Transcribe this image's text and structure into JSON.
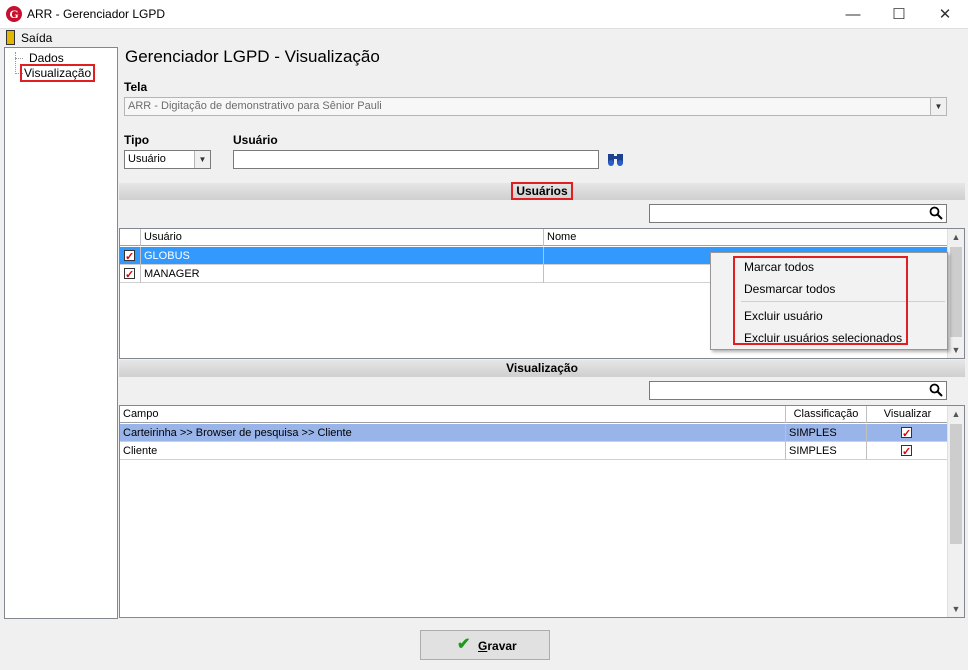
{
  "window": {
    "title": "ARR - Gerenciador LGPD",
    "logo_letter": "G",
    "minimize": "—",
    "maximize": "☐",
    "close": "✕"
  },
  "menu": {
    "exit_label": "Saída"
  },
  "tree": {
    "items": [
      {
        "label": "Dados"
      },
      {
        "label": "Visualização"
      }
    ]
  },
  "page": {
    "title": "Gerenciador LGPD - Visualização"
  },
  "screen_field": {
    "label": "Tela",
    "value": "ARR - Digitação de demonstrativo para Sênior Pauli"
  },
  "type_field": {
    "label": "Tipo",
    "value": "Usuário"
  },
  "user_field": {
    "label": "Usuário",
    "value": ""
  },
  "users_section": {
    "title": "Usuários",
    "search_value": "",
    "columns": [
      "",
      "Usuário",
      "Nome"
    ],
    "rows": [
      {
        "checked": true,
        "user": "GLOBUS",
        "name": "",
        "selected": true
      },
      {
        "checked": true,
        "user": "MANAGER",
        "name": "",
        "selected": false
      }
    ]
  },
  "context_menu": {
    "items": [
      "Marcar todos",
      "Desmarcar todos",
      "Excluir usuário",
      "Excluir usuários selecionados"
    ]
  },
  "view_section": {
    "title": "Visualização",
    "search_value": "",
    "columns": [
      "Campo",
      "Classificação",
      "Visualizar"
    ],
    "rows": [
      {
        "field": "Carteirinha >> Browser de pesquisa >> Cliente",
        "classification": "SIMPLES",
        "visible": true,
        "selected": true
      },
      {
        "field": "Cliente",
        "classification": "SIMPLES",
        "visible": true,
        "selected": false
      }
    ]
  },
  "footer": {
    "save_label_underlined": "G",
    "save_label_rest": "ravar"
  },
  "colors": {
    "selection_blue": "#3399ff",
    "selection_light": "#99b4e8",
    "highlight_red": "#e02020",
    "check_red": "#d00000",
    "save_green": "#1b9a1b"
  }
}
